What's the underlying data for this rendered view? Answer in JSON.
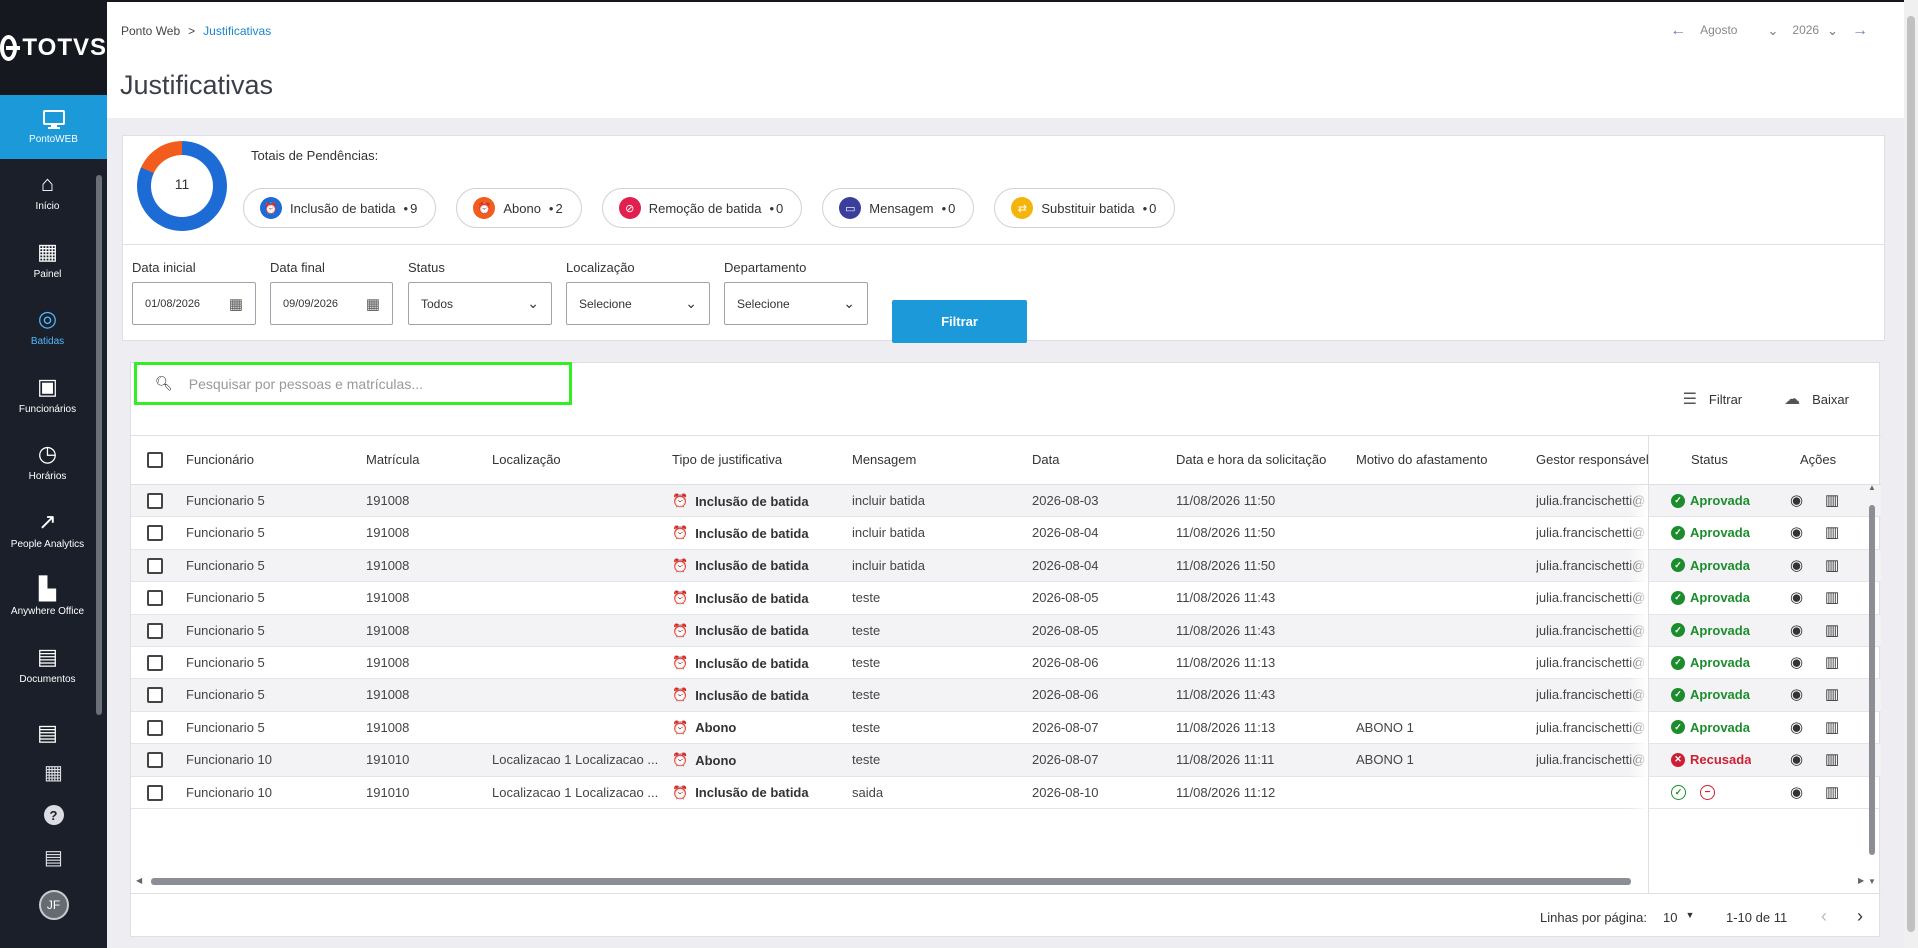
{
  "app": {
    "logo": "TOTVS"
  },
  "sidebar": {
    "active": {
      "label": "PontoWEB",
      "icon": "monitor-icon"
    },
    "items": [
      {
        "label": "Início",
        "icon": "home-icon",
        "name": "inicio"
      },
      {
        "label": "Painel",
        "icon": "dashboard-icon",
        "name": "painel"
      },
      {
        "label": "Batidas",
        "icon": "fingerprint-icon",
        "name": "batidas"
      },
      {
        "label": "Funcionários",
        "icon": "badge-icon",
        "name": "funcionarios"
      },
      {
        "label": "Horários",
        "icon": "clock-icon",
        "name": "horarios"
      },
      {
        "label": "People Analytics",
        "icon": "trending-icon",
        "name": "people-analytics"
      },
      {
        "label": "Anywhere Office",
        "icon": "office-icon",
        "name": "anywhere-office"
      },
      {
        "label": "Documentos",
        "icon": "document-icon",
        "name": "documentos"
      }
    ],
    "avatar": "JF"
  },
  "header": {
    "breadcrumb": [
      "Ponto Web",
      "Justificativas"
    ],
    "title": "Justificativas",
    "month": "Agosto",
    "year": "2026"
  },
  "summary": {
    "total": "11",
    "label": "Totais de Pendências:",
    "chips": [
      {
        "label": "Inclusão de batida",
        "count": "9",
        "color": "#1d6cd6",
        "icon": "alarm-icon"
      },
      {
        "label": "Abono",
        "count": "2",
        "color": "#f25c1d",
        "icon": "alarm-icon"
      },
      {
        "label": "Remoção de batida",
        "count": "0",
        "color": "#e0204f",
        "icon": "alarm-off-icon"
      },
      {
        "label": "Mensagem",
        "count": "0",
        "color": "#3a3f9c",
        "icon": "message-icon"
      },
      {
        "label": "Substituir batida",
        "count": "0",
        "color": "#f5b40a",
        "icon": "swap-icon"
      }
    ]
  },
  "filters": {
    "data_inicial": {
      "label": "Data inicial",
      "value": "01/08/2026"
    },
    "data_final": {
      "label": "Data final",
      "value": "09/09/2026"
    },
    "status": {
      "label": "Status",
      "value": "Todos"
    },
    "localizacao": {
      "label": "Localização",
      "value": "Selecione"
    },
    "departamento": {
      "label": "Departamento",
      "value": "Selecione"
    },
    "button": "Filtrar"
  },
  "table": {
    "search_placeholder": "Pesquisar por pessoas e matrículas...",
    "filter_label": "Filtrar",
    "download_label": "Baixar",
    "columns": [
      "Funcionário",
      "Matrícula",
      "Localização",
      "Tipo de justificativa",
      "Mensagem",
      "Data",
      "Data e hora da solicitação",
      "Motivo do afastamento",
      "Gestor responsável",
      "Status",
      "Ações"
    ],
    "rows": [
      {
        "funcionario": "Funcionario 5",
        "matricula": "191008",
        "localizacao": "",
        "tipo": "Inclusão de batida",
        "tipo_color": "#1d6cd6",
        "mensagem": "incluir batida",
        "data": "2026-08-03",
        "solicitacao": "11/08/2026 11:50",
        "motivo": "",
        "gestor": "julia.francischetti@",
        "status": "Aprovada"
      },
      {
        "funcionario": "Funcionario 5",
        "matricula": "191008",
        "localizacao": "",
        "tipo": "Inclusão de batida",
        "tipo_color": "#1d6cd6",
        "mensagem": "incluir batida",
        "data": "2026-08-04",
        "solicitacao": "11/08/2026 11:50",
        "motivo": "",
        "gestor": "julia.francischetti@",
        "status": "Aprovada"
      },
      {
        "funcionario": "Funcionario 5",
        "matricula": "191008",
        "localizacao": "",
        "tipo": "Inclusão de batida",
        "tipo_color": "#1d6cd6",
        "mensagem": "incluir batida",
        "data": "2026-08-04",
        "solicitacao": "11/08/2026 11:50",
        "motivo": "",
        "gestor": "julia.francischetti@",
        "status": "Aprovada"
      },
      {
        "funcionario": "Funcionario 5",
        "matricula": "191008",
        "localizacao": "",
        "tipo": "Inclusão de batida",
        "tipo_color": "#1d6cd6",
        "mensagem": "teste",
        "data": "2026-08-05",
        "solicitacao": "11/08/2026 11:43",
        "motivo": "",
        "gestor": "julia.francischetti@",
        "status": "Aprovada"
      },
      {
        "funcionario": "Funcionario 5",
        "matricula": "191008",
        "localizacao": "",
        "tipo": "Inclusão de batida",
        "tipo_color": "#1d6cd6",
        "mensagem": "teste",
        "data": "2026-08-05",
        "solicitacao": "11/08/2026 11:43",
        "motivo": "",
        "gestor": "julia.francischetti@",
        "status": "Aprovada"
      },
      {
        "funcionario": "Funcionario 5",
        "matricula": "191008",
        "localizacao": "",
        "tipo": "Inclusão de batida",
        "tipo_color": "#1d6cd6",
        "mensagem": "teste",
        "data": "2026-08-06",
        "solicitacao": "11/08/2026 11:13",
        "motivo": "",
        "gestor": "julia.francischetti@",
        "status": "Aprovada"
      },
      {
        "funcionario": "Funcionario 5",
        "matricula": "191008",
        "localizacao": "",
        "tipo": "Inclusão de batida",
        "tipo_color": "#1d6cd6",
        "mensagem": "teste",
        "data": "2026-08-06",
        "solicitacao": "11/08/2026 11:43",
        "motivo": "",
        "gestor": "julia.francischetti@",
        "status": "Aprovada"
      },
      {
        "funcionario": "Funcionario 5",
        "matricula": "191008",
        "localizacao": "",
        "tipo": "Abono",
        "tipo_color": "#f25c1d",
        "mensagem": "teste",
        "data": "2026-08-07",
        "solicitacao": "11/08/2026 11:13",
        "motivo": "ABONO 1",
        "gestor": "julia.francischetti@",
        "status": "Aprovada"
      },
      {
        "funcionario": "Funcionario 10",
        "matricula": "191010",
        "localizacao": "Localizacao 1 Localizacao ...",
        "tipo": "Abono",
        "tipo_color": "#f25c1d",
        "mensagem": "teste",
        "data": "2026-08-07",
        "solicitacao": "11/08/2026 11:11",
        "motivo": "ABONO 1",
        "gestor": "julia.francischetti@",
        "status": "Recusada"
      },
      {
        "funcionario": "Funcionario 10",
        "matricula": "191010",
        "localizacao": "Localizacao 1 Localizacao ...",
        "tipo": "Inclusão de batida",
        "tipo_color": "#1d6cd6",
        "mensagem": "saida",
        "data": "2026-08-10",
        "solicitacao": "11/08/2026 11:12",
        "motivo": "",
        "gestor": "",
        "status": ""
      }
    ],
    "footer": {
      "rows_per_page_label": "Linhas por página:",
      "rows_per_page": "10",
      "range": "1-10 de 11"
    }
  }
}
